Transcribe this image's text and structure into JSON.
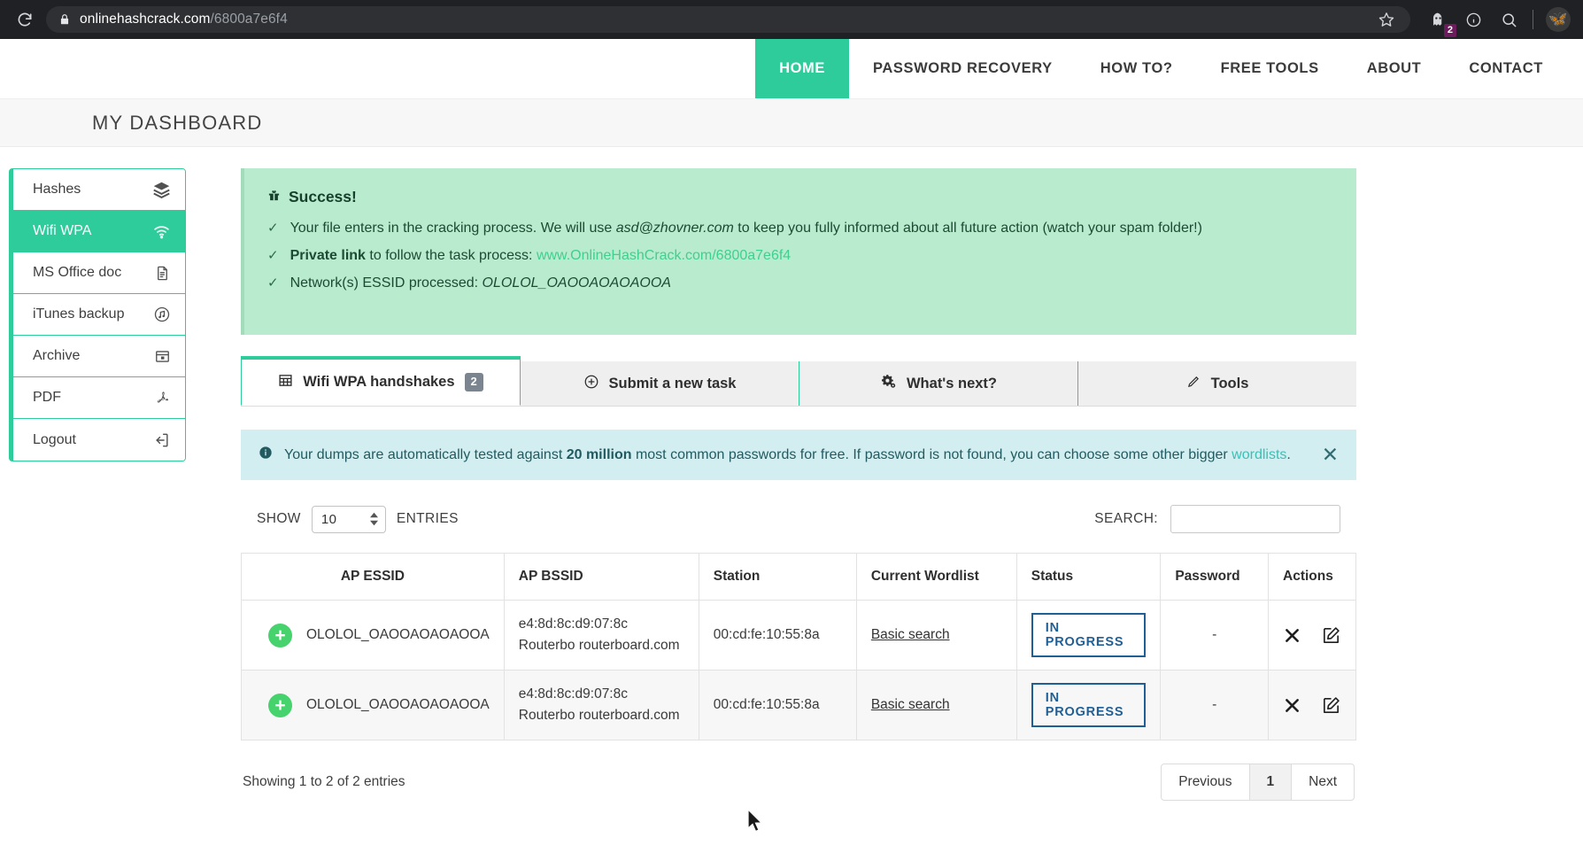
{
  "browser": {
    "url_domain": "onlinehashcrack.com",
    "url_path": "/6800a7e6f4",
    "reload_icon": "reload-icon",
    "lock_icon": "lock-icon",
    "bookmark_icon": "star-icon",
    "extension_icon": "ghost-extension-icon",
    "extension_badge": "2",
    "info_icon": "info-circle-icon",
    "search_icon": "search-icon",
    "avatar_icon": "profile-avatar"
  },
  "nav": {
    "items": [
      {
        "label": "HOME",
        "active": true
      },
      {
        "label": "PASSWORD RECOVERY",
        "active": false
      },
      {
        "label": "HOW TO?",
        "active": false
      },
      {
        "label": "FREE TOOLS",
        "active": false
      },
      {
        "label": "ABOUT",
        "active": false
      },
      {
        "label": "CONTACT",
        "active": false
      }
    ]
  },
  "dashboard": {
    "title": "MY DASHBOARD"
  },
  "sidebar": {
    "items": [
      {
        "label": "Hashes",
        "icon": "layers-icon",
        "active": false
      },
      {
        "label": "Wifi WPA",
        "icon": "wifi-icon",
        "active": true
      },
      {
        "label": "MS Office doc",
        "icon": "document-icon",
        "active": false
      },
      {
        "label": "iTunes backup",
        "icon": "music-note-circle-icon",
        "active": false
      },
      {
        "label": "Archive",
        "icon": "archive-box-icon",
        "active": false
      },
      {
        "label": "PDF",
        "icon": "pdf-icon",
        "active": false
      },
      {
        "label": "Logout",
        "icon": "logout-icon",
        "active": false
      }
    ]
  },
  "alert": {
    "title": "Success!",
    "gift_icon": "gift-icon",
    "lines": [
      {
        "pre": "Your file enters in the cracking process. We will use ",
        "em": "asd@zhovner.com",
        "post": "  to keep you fully informed about all future action (watch your spam folder!)"
      },
      {
        "strong": "Private link",
        "pre": " to follow the task process: ",
        "link": "www.OnlineHashCrack.com/6800a7e6f4"
      },
      {
        "pre": "Network(s) ESSID processed: ",
        "em": "OLOLOL_OAOOAOAOAOOA"
      }
    ]
  },
  "tabs": [
    {
      "label": "Wifi WPA handshakes",
      "badge": "2",
      "icon": "table-grid-icon",
      "active": true
    },
    {
      "label": "Submit a new task",
      "badge": "",
      "icon": "plus-circle-icon",
      "active": false
    },
    {
      "label": "What's next?",
      "badge": "",
      "icon": "gears-icon",
      "active": false
    },
    {
      "label": "Tools",
      "badge": "",
      "icon": "pencil-icon",
      "active": false
    }
  ],
  "info_banner": {
    "icon": "info-icon",
    "pre": "Your dumps are automatically tested against ",
    "strong": "20 million",
    "mid": " most common passwords for free. If password is not found, you can choose some other bigger ",
    "link": "wordlists",
    "post": ".",
    "close_icon": "close-icon"
  },
  "table_controls": {
    "show_label": "SHOW",
    "entries_label": "ENTRIES",
    "page_size": "10",
    "search_label": "SEARCH:",
    "search_value": "",
    "search_placeholder": ""
  },
  "table": {
    "headers": [
      "AP ESSID",
      "AP BSSID",
      "Station",
      "Current Wordlist",
      "Status",
      "Password",
      "Actions"
    ],
    "rows": [
      {
        "essid": "OLOLOL_OAOOAOAOAOOA",
        "bssid_mac": "e4:8d:8c:d9:07:8c",
        "bssid_vendor": "Routerbo routerboard.com",
        "station": "00:cd:fe:10:55:8a",
        "wordlist": "Basic search",
        "status": "IN PROGRESS",
        "password": "-",
        "delete_icon": "close-x-icon",
        "edit_icon": "edit-pencil-icon"
      },
      {
        "essid": "OLOLOL_OAOOAOAOAOOA",
        "bssid_mac": "e4:8d:8c:d9:07:8c",
        "bssid_vendor": "Routerbo routerboard.com",
        "station": "00:cd:fe:10:55:8a",
        "wordlist": "Basic search",
        "status": "IN PROGRESS",
        "password": "-",
        "delete_icon": "close-x-icon",
        "edit_icon": "edit-pencil-icon"
      }
    ]
  },
  "footer": {
    "entries_info": "Showing 1 to 2 of 2 entries",
    "pager": [
      {
        "label": "Previous",
        "current": false
      },
      {
        "label": "1",
        "current": true
      },
      {
        "label": "Next",
        "current": false
      }
    ]
  },
  "colors": {
    "brand_green": "#2ecc9b",
    "success_bg": "#b9ebce",
    "info_bg": "#d3eef0",
    "status_blue": "#1f5f95"
  }
}
